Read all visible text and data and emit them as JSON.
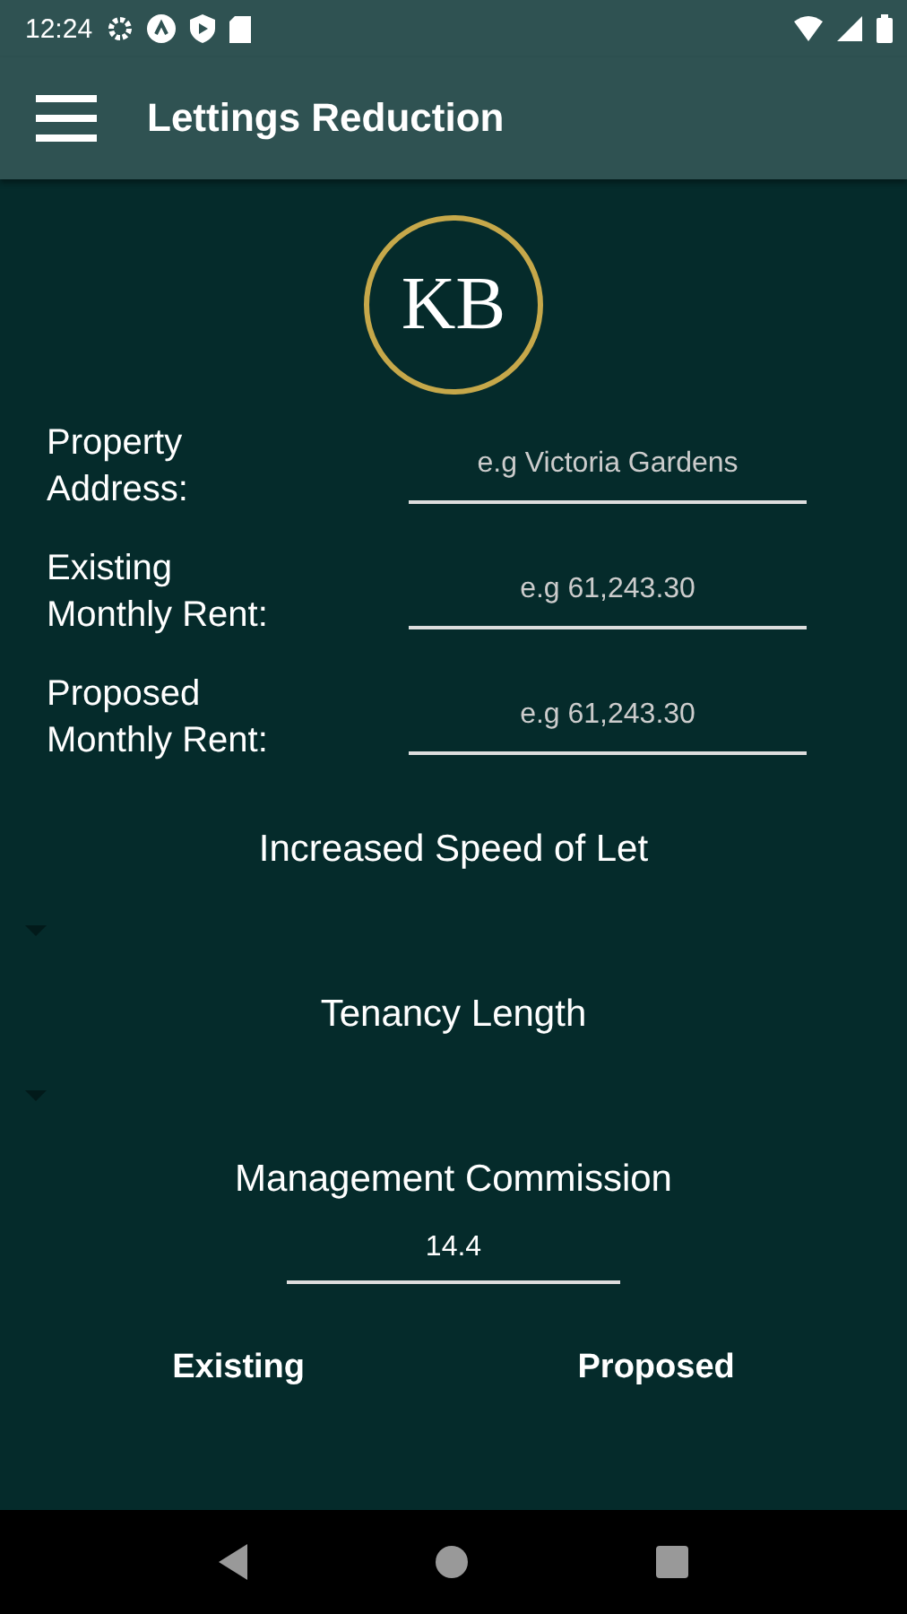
{
  "status_bar": {
    "time": "12:24"
  },
  "app_bar": {
    "title": "Lettings Reduction"
  },
  "logo": {
    "text": "KB"
  },
  "fields": [
    {
      "label": "Property Address:",
      "placeholder": "e.g Victoria Gardens"
    },
    {
      "label": "Existing Monthly Rent:",
      "placeholder": "e.g 61,243.30"
    },
    {
      "label": "Proposed Monthly Rent:",
      "placeholder": "e.g 61,243.30"
    }
  ],
  "dropdowns": [
    {
      "heading": "Increased Speed of Let"
    },
    {
      "heading": "Tenancy Length"
    }
  ],
  "management_commission": {
    "heading": "Management Commission",
    "value": "14.4"
  },
  "columns": [
    "Existing",
    "Proposed"
  ]
}
